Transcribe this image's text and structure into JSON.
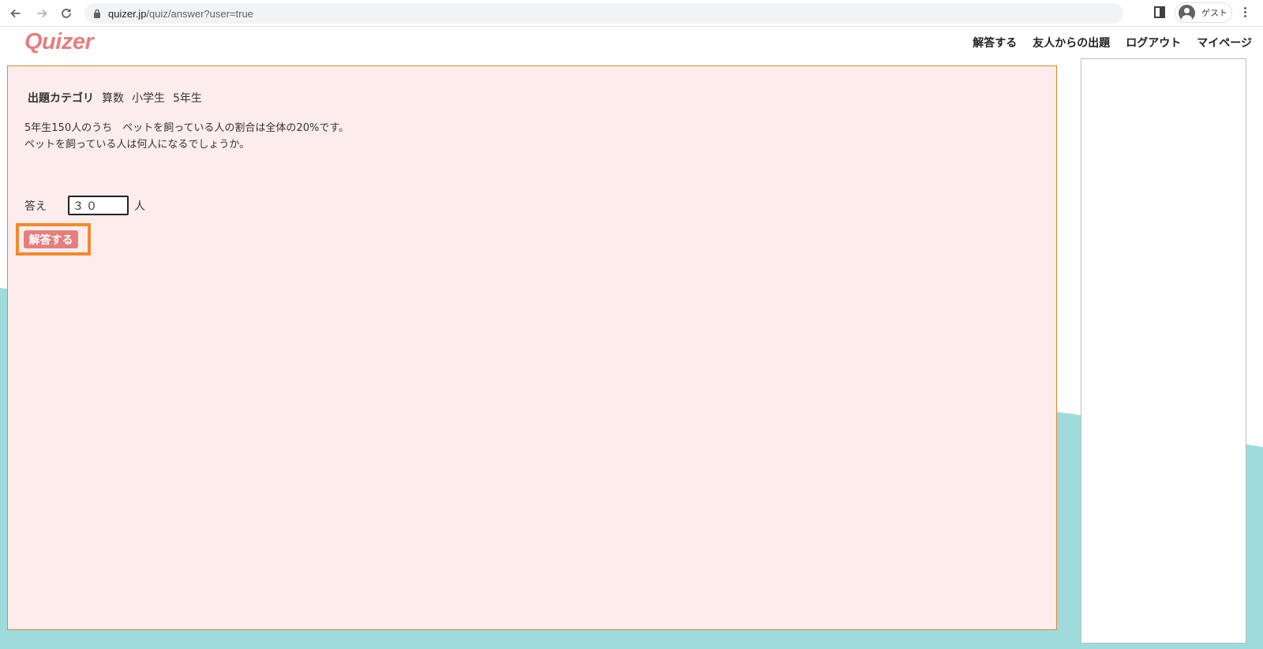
{
  "browser": {
    "url_host": "quizer.jp",
    "url_path": "/quiz/answer?user=true",
    "profile_label": "ゲスト"
  },
  "site": {
    "logo": "Quizer",
    "nav": [
      "解答する",
      "友人からの出題",
      "ログアウト",
      "マイページ"
    ]
  },
  "quiz": {
    "category_label": "出題カテゴリ",
    "category_subject": "算数",
    "category_level": "小学生",
    "category_grade": "5年生",
    "question_line1": "5年生150人のうち　ペットを飼っている人の割合は全体の20%です。",
    "question_line2": "ペットを飼っている人は何人になるでしょうか。",
    "answer_label": "答え",
    "answer_value": "３０",
    "answer_unit": "人",
    "submit_label": "解答する"
  },
  "colors": {
    "accent": "#e57f7f",
    "highlight": "#f28a2c",
    "panel_bg": "#fdecec",
    "teal": "#9fdbdc"
  }
}
